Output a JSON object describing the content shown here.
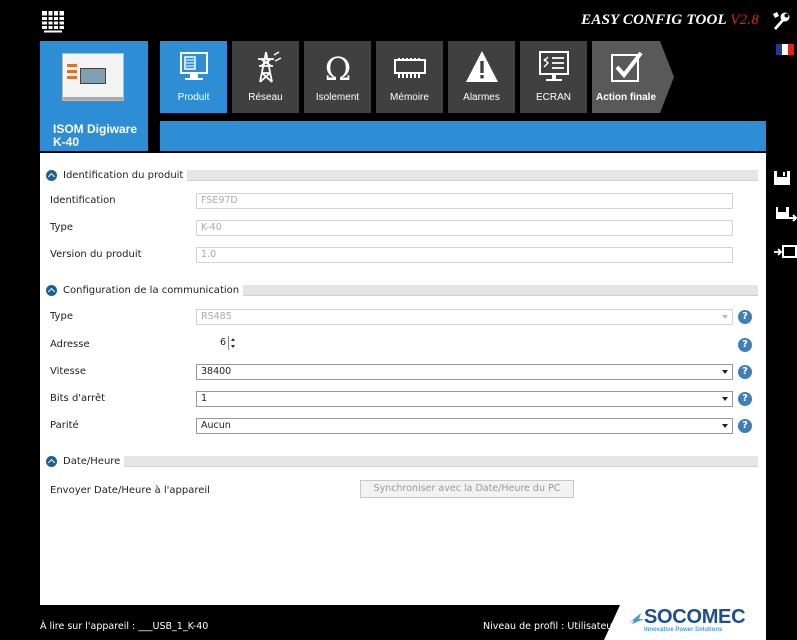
{
  "header": {
    "title": "EASY CONFIG TOOL",
    "version": "V2.8"
  },
  "device": {
    "name_line1": "ISOM Digiware",
    "name_line2": "K-40"
  },
  "tabs": [
    {
      "label": "Produit",
      "icon": "monitor-icon",
      "active": true
    },
    {
      "label": "Réseau",
      "icon": "pylon-icon",
      "active": false
    },
    {
      "label": "Isolement",
      "icon": "omega-icon",
      "active": false
    },
    {
      "label": "Mémoire",
      "icon": "memory-chip-icon",
      "active": false
    },
    {
      "label": "Alarmes",
      "icon": "warning-icon",
      "active": false
    },
    {
      "label": "ECRAN",
      "icon": "screen-icon",
      "active": false
    },
    {
      "label": "Action finale",
      "icon": "checkmark-icon",
      "active": false
    }
  ],
  "sections": {
    "identification": {
      "title": "Identification du produit",
      "fields": [
        {
          "label": "Identification",
          "value": "FSE97D"
        },
        {
          "label": "Type",
          "value": "K-40"
        },
        {
          "label": "Version du produit",
          "value": "1.0"
        }
      ]
    },
    "communication": {
      "title": "Configuration de la communication",
      "type": {
        "label": "Type",
        "value": "RS485"
      },
      "address": {
        "label": "Adresse",
        "value": "6"
      },
      "speed": {
        "label": "Vitesse",
        "value": "38400"
      },
      "stop_bits": {
        "label": "Bits d'arrêt",
        "value": "1"
      },
      "parity": {
        "label": "Parité",
        "value": "Aucun"
      },
      "help_symbol": "?"
    },
    "datetime": {
      "title": "Date/Heure",
      "send_label": "Envoyer Date/Heure à l'appareil",
      "sync_button": "Synchroniser avec la Date/Heure du PC"
    }
  },
  "footer": {
    "device_read": "À lire sur l'appareil : ___USB_1_K-40",
    "profile": "Niveau de profil : Utilisateur",
    "logo": "SOCOMEC",
    "logo_tagline": "Innovative Power Solutions"
  },
  "colors": {
    "accent_blue": "#2d8dd5",
    "version_red": "#e0201b",
    "tab_dark": "#404040",
    "help_blue": "#3f7fb9"
  }
}
